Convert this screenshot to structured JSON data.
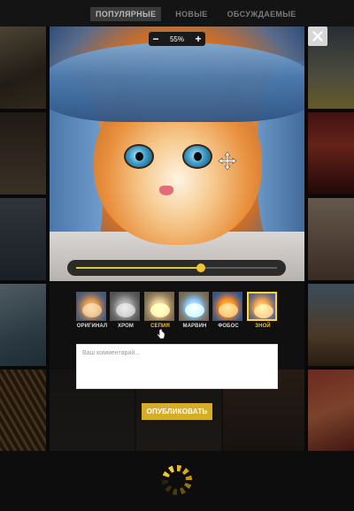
{
  "nav": {
    "tabs": [
      {
        "label": "ПОПУЛЯРНЫЕ",
        "active": true
      },
      {
        "label": "НОВЫЕ",
        "active": false
      },
      {
        "label": "ОБСУЖДАЕМЫЕ",
        "active": false
      }
    ]
  },
  "zoom": {
    "minus": "−",
    "plus": "+",
    "value": "55%"
  },
  "slider": {
    "value": 0.62
  },
  "filters": [
    {
      "label": "ОРИГИНАЛ",
      "selected": false
    },
    {
      "label": "ХРОМ",
      "selected": false
    },
    {
      "label": "СЕПИЯ",
      "selected": false
    },
    {
      "label": "МАРВИН",
      "selected": false
    },
    {
      "label": "ФОБОС",
      "selected": false
    },
    {
      "label": "ЗНОЙ",
      "selected": true
    }
  ],
  "comment": {
    "placeholder": "Ваш комментарий..."
  },
  "publish": {
    "label": "ОПУБЛИКОВАТЬ"
  },
  "colors": {
    "accent": "#f0c530",
    "button": "#d7ac2a"
  }
}
